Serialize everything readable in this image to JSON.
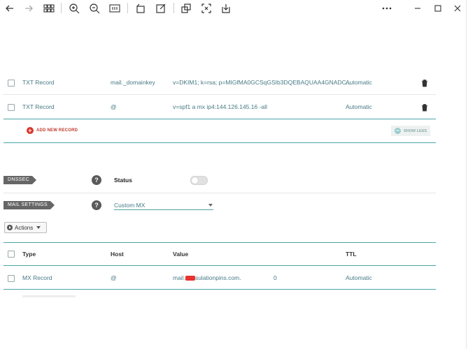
{
  "toolbar": {
    "icons": [
      "back-arrow-icon",
      "forward-arrow-icon",
      "grid-icon",
      "zoom-in-icon",
      "zoom-out-icon",
      "fit-width-icon",
      "rotate-icon",
      "edit-icon",
      "crop-icon",
      "fit-screen-icon",
      "download-icon",
      "more-icon",
      "minimize-icon",
      "maximize-icon",
      "close-icon"
    ]
  },
  "records": [
    {
      "type": "TXT Record",
      "host": "mail._domainkey",
      "value": "v=DKIM1; k=rsa; p=MIGfMA0GCSqGSIb3DQEBAQUAA4GNADC...",
      "ttl": "Automatic"
    },
    {
      "type": "TXT Record",
      "host": "@",
      "value": "v=spf1 a mx ip4:144.126.145.16 -all",
      "ttl": "Automatic"
    }
  ],
  "add_new_record_label": "ADD NEW RECORD",
  "show_less_label": "SHOW LESS",
  "dnssec": {
    "tag": "DNSSEC",
    "help": "?",
    "status_label": "Status"
  },
  "mail_settings": {
    "tag": "MAIL SETTINGS",
    "help": "?",
    "selected": "Custom MX"
  },
  "actions_label": "Actions",
  "mx_table": {
    "headers": {
      "type": "Type",
      "host": "Host",
      "value": "Value",
      "ttl": "TTL"
    },
    "rows": [
      {
        "type": "MX Record",
        "host": "@",
        "value_prefix": "mail.",
        "value_suffix": "sulationpins.com.",
        "priority": "0",
        "ttl": "Automatic"
      }
    ]
  },
  "colors": {
    "accent": "#4aa3a6",
    "text_teal": "#477a86",
    "add_red": "#d9342b"
  }
}
